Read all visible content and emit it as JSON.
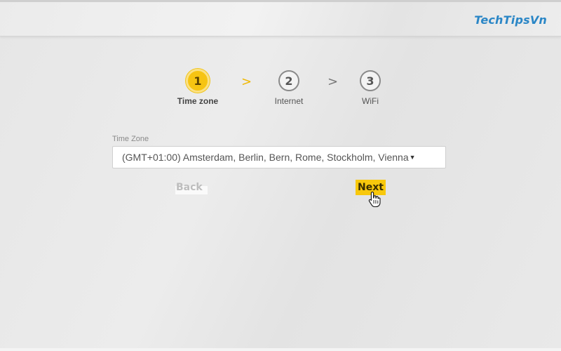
{
  "watermark": "TechTipsVn",
  "steps": [
    {
      "number": "1",
      "label": "Time zone",
      "state": "active"
    },
    {
      "number": "2",
      "label": "Internet",
      "state": "inactive"
    },
    {
      "number": "3",
      "label": "WiFi",
      "state": "inactive"
    }
  ],
  "separator": ">",
  "timezone": {
    "label": "Time Zone",
    "value": "(GMT+01:00) Amsterdam, Berlin, Bern, Rome, Stockholm, Vienna"
  },
  "buttons": {
    "back": "Back",
    "next": "Next"
  },
  "icons": {
    "caret": "triangle-down-icon",
    "cursor": "hand-pointer-icon"
  },
  "colors": {
    "accent": "#f6c412",
    "watermark": "#2a86c6"
  }
}
